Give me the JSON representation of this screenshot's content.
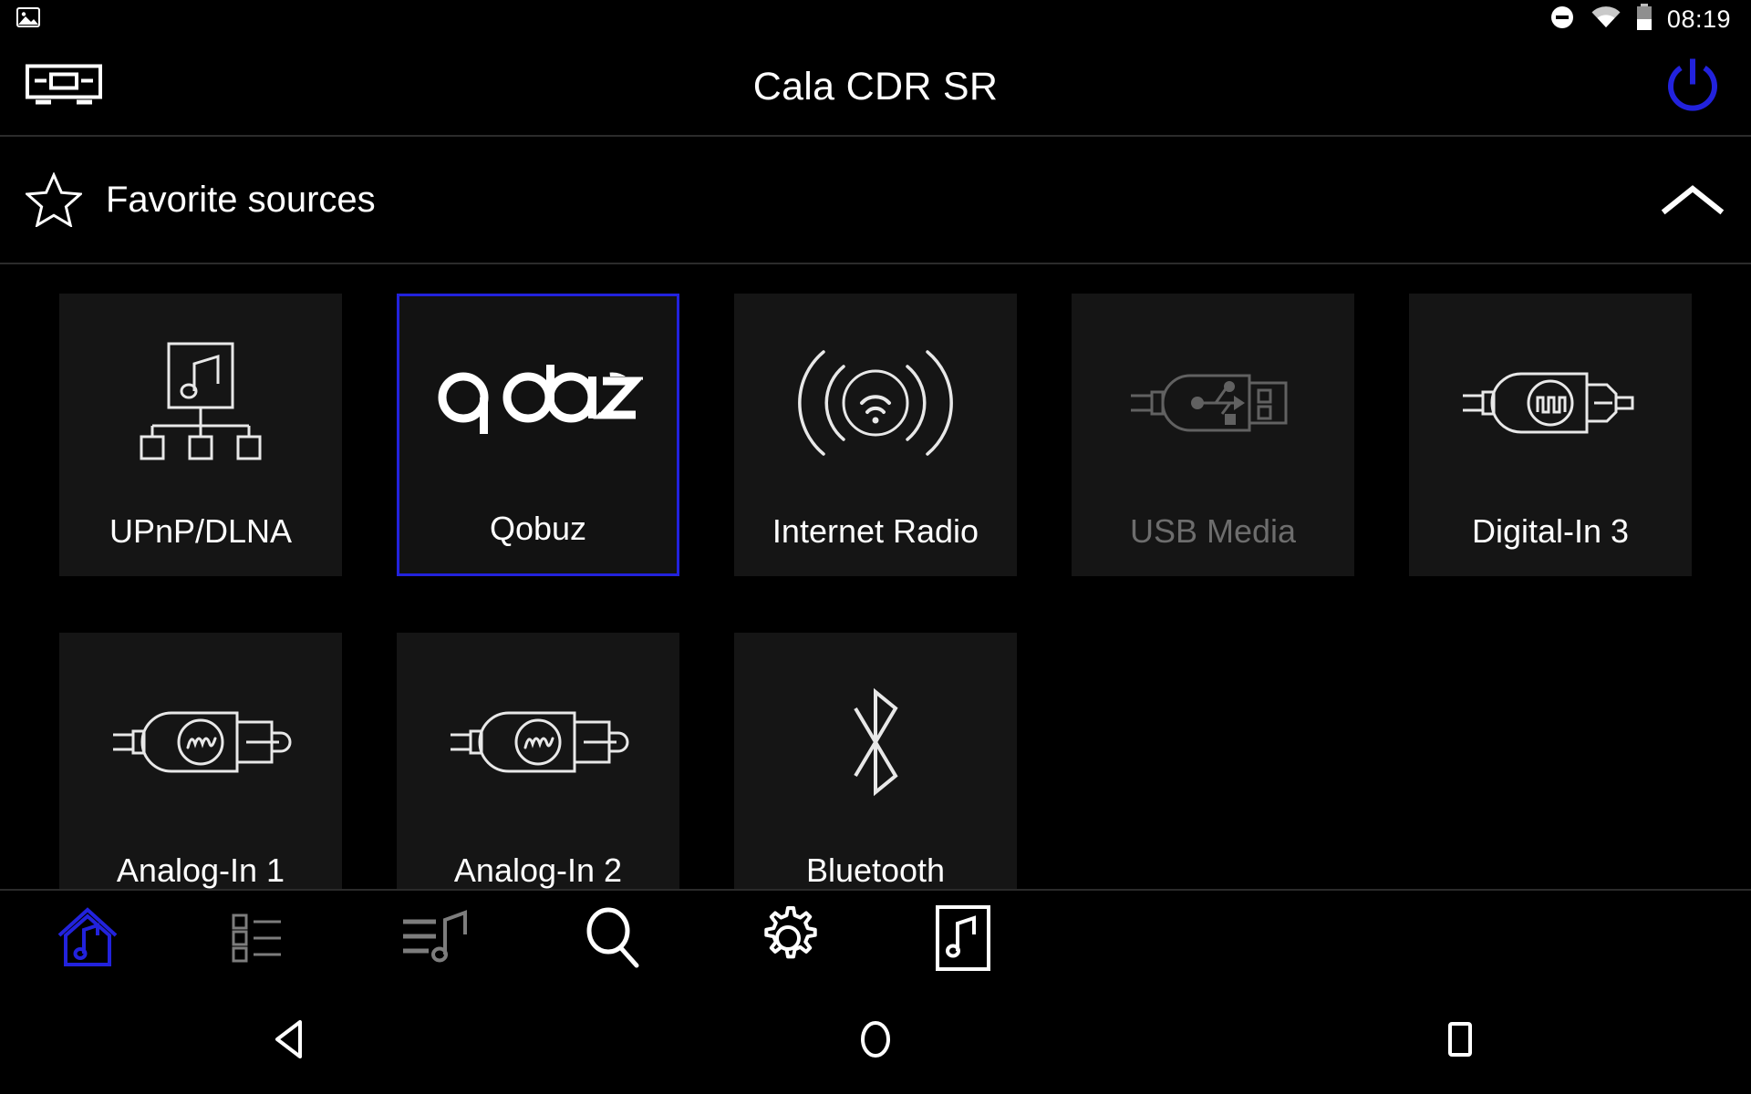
{
  "statusbar": {
    "time": "08:19",
    "icons": [
      "screenshot-icon",
      "do-not-disturb-icon",
      "wifi-icon",
      "battery-icon"
    ]
  },
  "titlebar": {
    "device_icon": "hifi-device-icon",
    "title": "Cala CDR SR",
    "power_icon": "power-icon",
    "power_color": "#2222dd"
  },
  "section": {
    "star_icon": "star-outline-icon",
    "title": "Favorite sources",
    "collapse_icon": "chevron-up-icon"
  },
  "tiles": [
    {
      "id": "upnp-dlna",
      "label": "UPnP/DLNA",
      "icon": "upnp-network-music-icon",
      "selected": false,
      "disabled": false
    },
    {
      "id": "qobuz",
      "label": "Qobuz",
      "icon": "qobuz-logo",
      "selected": true,
      "disabled": false
    },
    {
      "id": "internet-radio",
      "label": "Internet Radio",
      "icon": "radio-waves-icon",
      "selected": false,
      "disabled": false
    },
    {
      "id": "usb-media",
      "label": "USB Media",
      "icon": "usb-plug-icon",
      "selected": false,
      "disabled": true
    },
    {
      "id": "digital-in-3",
      "label": "Digital-In 3",
      "icon": "rca-square-wave-icon",
      "selected": false,
      "disabled": false
    },
    {
      "id": "analog-in-1",
      "label": "Analog-In 1",
      "icon": "rca-sine-wave-icon",
      "selected": false,
      "disabled": false
    },
    {
      "id": "analog-in-2",
      "label": "Analog-In 2",
      "icon": "rca-sine-wave-icon",
      "selected": false,
      "disabled": false
    },
    {
      "id": "bluetooth",
      "label": "Bluetooth",
      "icon": "bluetooth-icon",
      "selected": false,
      "disabled": false
    }
  ],
  "qobuz_wordmark": "qobuz",
  "bottom_nav": [
    {
      "id": "home",
      "icon": "home-music-icon",
      "active": true,
      "state": "active"
    },
    {
      "id": "browse",
      "icon": "list-icon",
      "active": false,
      "state": "dim"
    },
    {
      "id": "queue",
      "icon": "playlist-icon",
      "active": false,
      "state": "dim"
    },
    {
      "id": "search",
      "icon": "search-icon",
      "active": false,
      "state": "normal"
    },
    {
      "id": "settings",
      "icon": "gear-icon",
      "active": false,
      "state": "normal"
    },
    {
      "id": "now-playing",
      "icon": "now-playing-icon",
      "active": false,
      "state": "normal"
    }
  ],
  "android_nav": [
    {
      "id": "back",
      "icon": "back-triangle-icon"
    },
    {
      "id": "home",
      "icon": "home-circle-icon"
    },
    {
      "id": "recents",
      "icon": "recents-square-icon"
    }
  ],
  "colors": {
    "accent": "#2222dd",
    "tile_bg": "#151515",
    "disabled_text": "#6d6d6d",
    "divider": "#2b2b2b",
    "background": "#000000"
  }
}
